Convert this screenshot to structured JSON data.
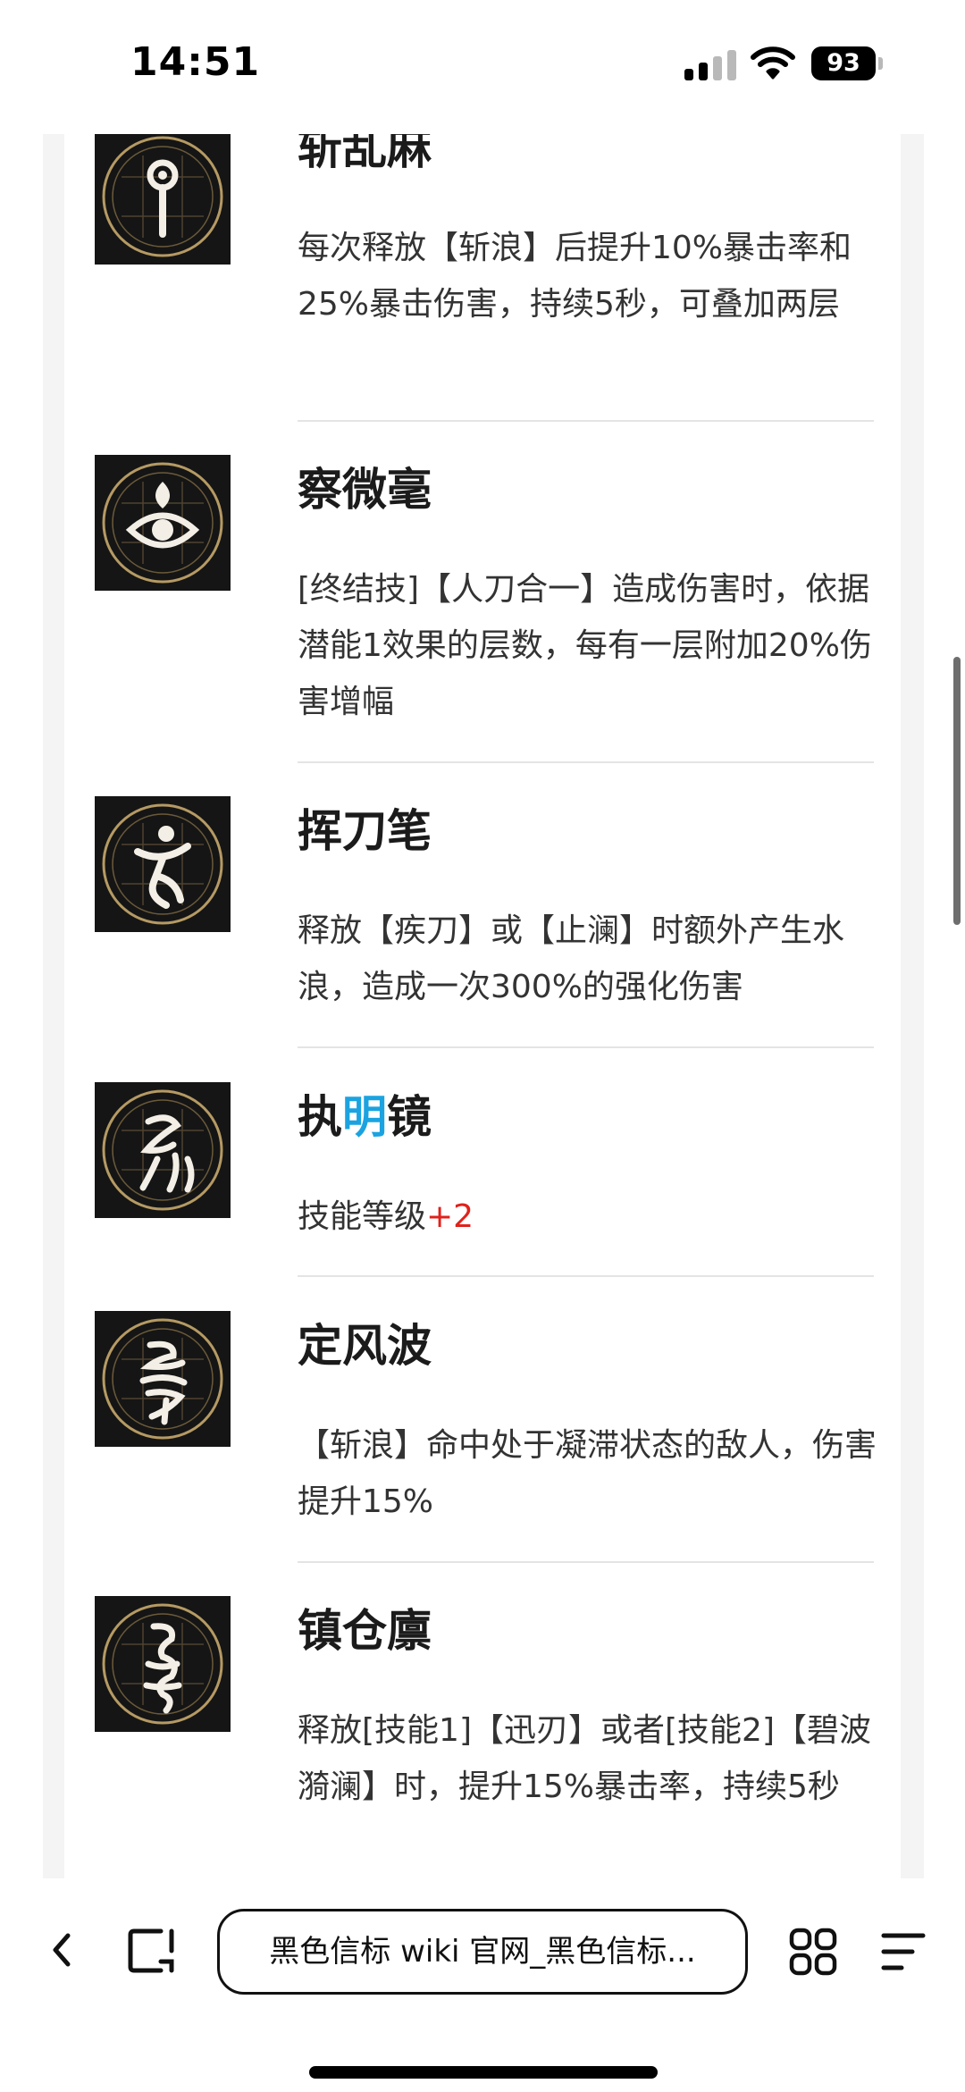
{
  "status_bar": {
    "time": "14:51",
    "battery_level": "93",
    "signal_icon": "cellular-signal-icon",
    "wifi_icon": "wifi-icon",
    "battery_icon": "battery-icon"
  },
  "skills": [
    {
      "title": "斩乱麻",
      "desc": "每次释放【斩浪】后提升10%暴击率和25%暴击伤害，持续5秒，可叠加两层",
      "icon": "rune-emblem-1-icon"
    },
    {
      "title": "察微毫",
      "desc": "[终结技]【人刀合一】造成伤害时，依据潜能1效果的层数，每有一层附加20%伤害增幅",
      "icon": "rune-emblem-2-icon"
    },
    {
      "title": "挥刀笔",
      "desc": "释放【疾刀】或【止澜】时额外产生水浪，造成一次300%的强化伤害",
      "icon": "rune-emblem-3-icon"
    },
    {
      "title_part1": "执",
      "title_highlight": "明",
      "title_part2": "镜",
      "desc": "技能等级",
      "desc_value": "+2",
      "icon": "rune-emblem-4-icon"
    },
    {
      "title": "定风波",
      "desc": "【斩浪】命中处于凝滞状态的敌人，伤害提升15%",
      "icon": "rune-emblem-5-icon"
    },
    {
      "title": "镇仓廪",
      "desc": "释放[技能1]【迅刃】或者[技能2]【碧波漪澜】时，提升15%暴击率，持续5秒",
      "icon": "rune-emblem-6-icon"
    }
  ],
  "colors": {
    "highlight_blue": "#1aa3e0",
    "highlight_red": "#e0211b",
    "icon_gold": "#b59a63"
  },
  "toolbar": {
    "url_text": "黑色信标 wiki 官网_黑色信标...",
    "back_icon": "chevron-left-icon",
    "tabs_icon": "tabs-icon",
    "grid_icon": "grid-icon",
    "menu_icon": "menu-icon"
  }
}
